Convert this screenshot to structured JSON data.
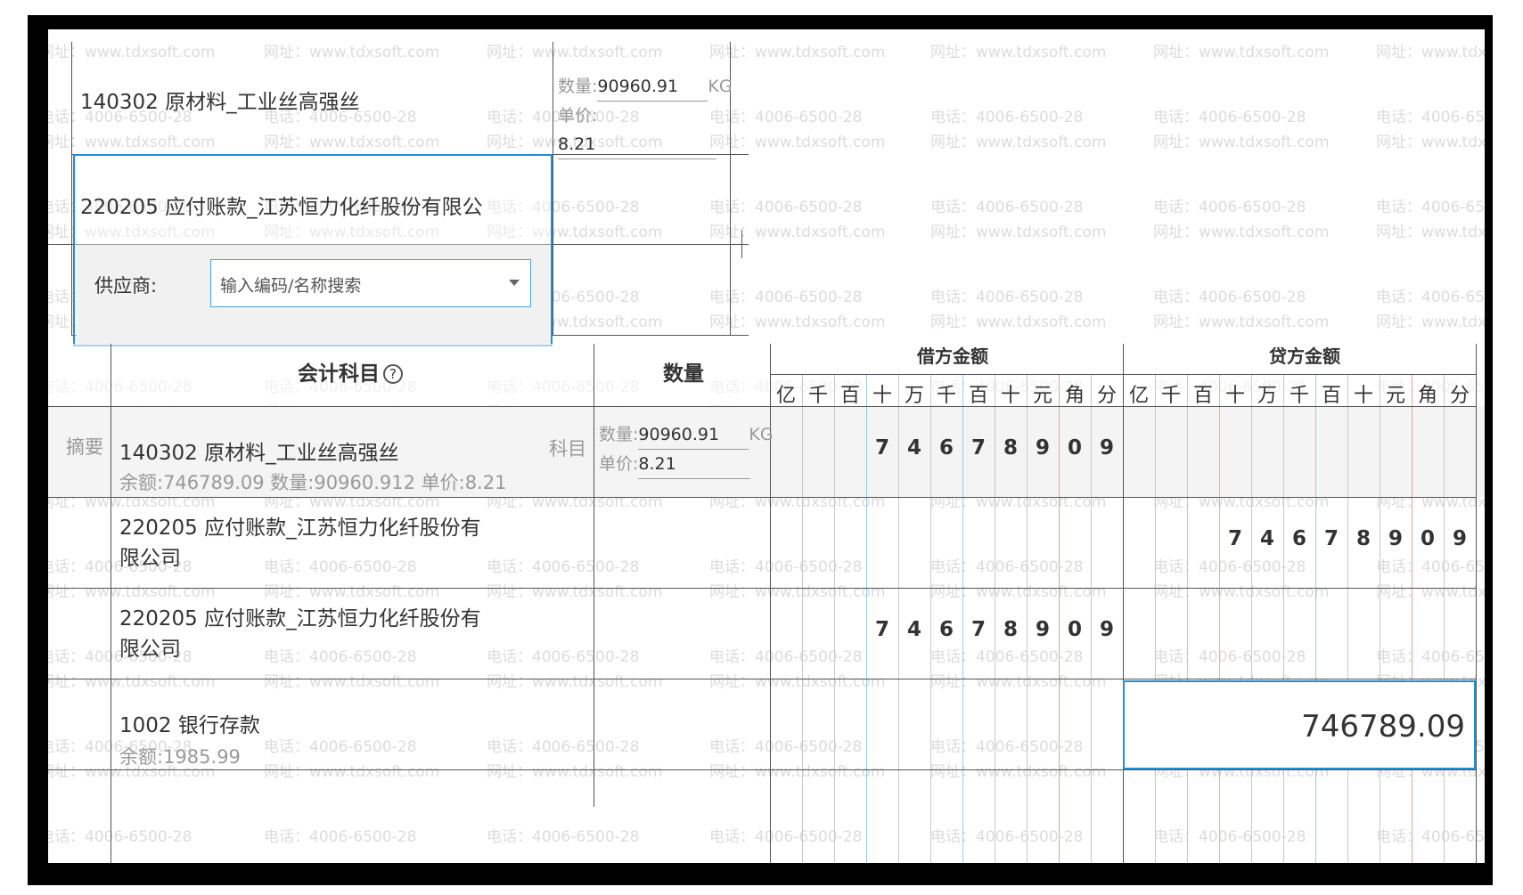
{
  "watermark": {
    "phone": "电话：4006-6500-28",
    "site": "网址：www.tdxsoft.com"
  },
  "popup": {
    "row1": {
      "account": "140302 原材料_工业丝高强丝",
      "qty_label": "数量:",
      "qty_value": "90960.91",
      "qty_unit": "KG",
      "price_label": "单价:",
      "price_value": "8.21"
    },
    "row2": {
      "account": "220205 应付账款_江苏恒力化纤股份有限公"
    },
    "supplier": {
      "label": "供应商:",
      "placeholder": "输入编码/名称搜索"
    }
  },
  "table": {
    "headers": {
      "account": "会计科目",
      "info_icon": "?",
      "quantity": "数量",
      "debit": "借方金额",
      "credit": "贷方金额",
      "digit_units": [
        "亿",
        "千",
        "百",
        "十",
        "万",
        "千",
        "百",
        "十",
        "元",
        "角",
        "分"
      ]
    },
    "rows": [
      {
        "summary_label": "摘要",
        "account": "140302 原材料_工业丝高强丝",
        "account_label": "科目",
        "sub": "余额:746789.09   数量:90960.912 单价:8.21",
        "qty_label": "数量:",
        "qty_value": "90960.91",
        "qty_unit": "KG",
        "price_label": "单价:",
        "price_value": "8.21",
        "debit_digits": [
          "7",
          "4",
          "6",
          "7",
          "8",
          "9",
          "0",
          "9"
        ],
        "credit_digits": []
      },
      {
        "account_line1": "220205 应付账款_江苏恒力化纤股份有",
        "account_line2": "限公司",
        "debit_digits": [],
        "credit_digits": [
          "7",
          "4",
          "6",
          "7",
          "8",
          "9",
          "0",
          "9"
        ]
      },
      {
        "account_line1": "220205 应付账款_江苏恒力化纤股份有",
        "account_line2": "限公司",
        "debit_digits": [
          "7",
          "4",
          "6",
          "7",
          "8",
          "9",
          "0",
          "9"
        ],
        "credit_digits": []
      },
      {
        "account": "1002 银行存款",
        "sub": "余额:1985.99",
        "credit_input": "746789.09"
      }
    ]
  },
  "colors": {
    "accent": "#1e90d6",
    "wan_line": "#9ec8e8",
    "yuan_line": "#e8a0a0",
    "grid_line": "#555555",
    "watermark": "#dcdcdc"
  }
}
